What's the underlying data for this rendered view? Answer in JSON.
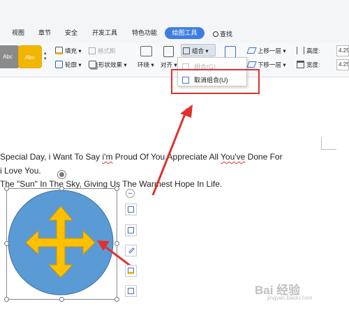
{
  "tabs": [
    "视图",
    "章节",
    "安全",
    "开发工具",
    "特色功能"
  ],
  "active_tab": "绘图工具",
  "search_label": "查找",
  "ribbon": {
    "style_swatches": [
      {
        "label": "Abc",
        "color": "#8b8b8b"
      },
      {
        "label": "Abc",
        "color": "#f2b600"
      }
    ],
    "fill": "填充",
    "format_brush": "格式刷",
    "outline": "轮廓",
    "shape_effects": "形状效果",
    "surround": "环绕",
    "align": "对齐",
    "group": "组合",
    "bring_forward": "上移一层",
    "send_backward": "下移一层",
    "height_label": "高度:",
    "width_label": "宽度:",
    "height_value": "4.25",
    "width_value": "4.25"
  },
  "menu": {
    "items": [
      {
        "label": "组合(G)",
        "enabled": false
      },
      {
        "label": "取消组合(U)",
        "enabled": true
      }
    ]
  },
  "document": {
    "line1_a": "Special Day, i Want To Say ",
    "line1_b": "i'm",
    "line1_c": " Proud Of You,Appreciate All ",
    "line1_d": "You've",
    "line1_e": " Done For",
    "line2": "i Love You.",
    "line3": "The \"Sun\" In The Sky, Giving Us The Warmest Hope In Life."
  },
  "colors": {
    "accent": "#3d7ee0",
    "circle_fill": "#5b9bd5",
    "arrow_fill": "#ffc000",
    "annotation_red": "#e0312e"
  },
  "watermark": {
    "text": "Bai 经验",
    "sub": "jingyan.baidu.com"
  }
}
